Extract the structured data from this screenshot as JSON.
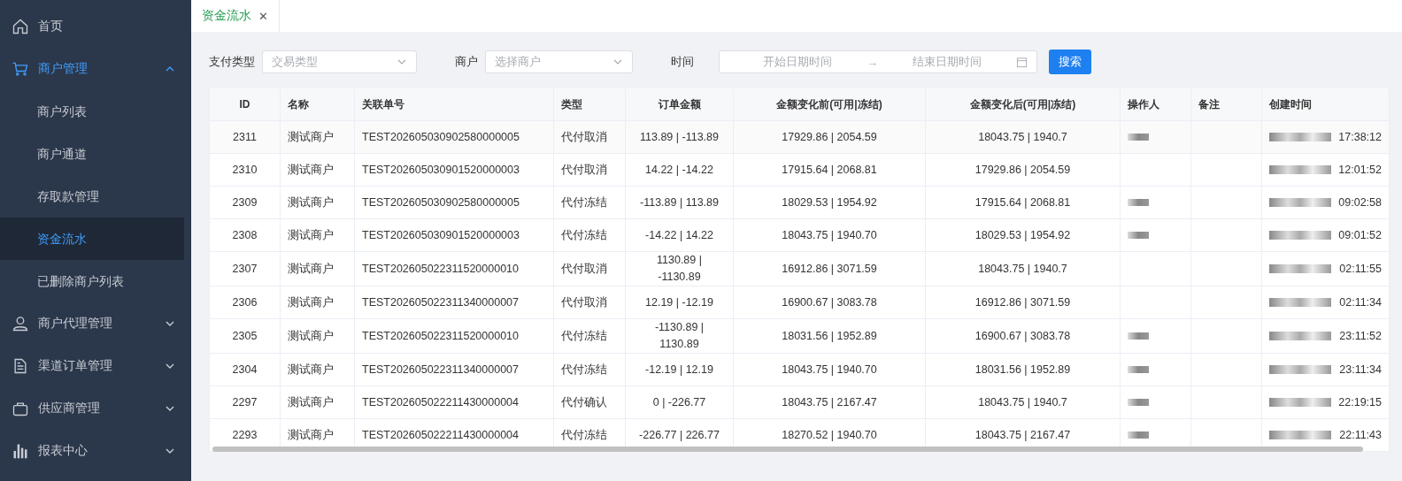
{
  "sidebar": {
    "items": [
      {
        "label": "首页",
        "expanded": false,
        "has_children": false
      },
      {
        "label": "商户管理",
        "expanded": true,
        "has_children": true,
        "children": [
          {
            "label": "商户列表",
            "selected": false
          },
          {
            "label": "商户通道",
            "selected": false
          },
          {
            "label": "存取款管理",
            "selected": false
          },
          {
            "label": "资金流水",
            "selected": true
          },
          {
            "label": "已删除商户列表",
            "selected": false
          }
        ]
      },
      {
        "label": "商户代理管理",
        "expanded": false,
        "has_children": true
      },
      {
        "label": "渠道订单管理",
        "expanded": false,
        "has_children": true
      },
      {
        "label": "供应商管理",
        "expanded": false,
        "has_children": true
      },
      {
        "label": "报表中心",
        "expanded": false,
        "has_children": true
      }
    ]
  },
  "tabs": [
    {
      "label": "资金流水",
      "selected": true,
      "close": "✕"
    }
  ],
  "filters": {
    "pay_type": {
      "label": "支付类型",
      "placeholder": "交易类型"
    },
    "merchant": {
      "label": "商户",
      "placeholder": "选择商户"
    },
    "time": {
      "label": "时间",
      "start_placeholder": "开始日期时间",
      "separator": "→",
      "end_placeholder": "结束日期时间"
    },
    "search_button": "搜索"
  },
  "table": {
    "columns": [
      "ID",
      "名称",
      "关联单号",
      "类型",
      "订单金额",
      "金额变化前(可用|冻结)",
      "金额变化后(可用|冻结)",
      "操作人",
      "备注",
      "创建时间"
    ],
    "rows": [
      {
        "id": "2311",
        "name": "测试商户",
        "ref": "TEST202605030902580000005",
        "type": "代付取消",
        "amount": "113.89 | -113.89",
        "before": "17929.86 | 2054.59",
        "after": "18043.75 | 1940.7",
        "operator_redacted": true,
        "time": "17:38:12"
      },
      {
        "id": "2310",
        "name": "测试商户",
        "ref": "TEST202605030901520000003",
        "type": "代付取消",
        "amount": "14.22 | -14.22",
        "before": "17915.64 | 2068.81",
        "after": "17929.86 | 2054.59",
        "operator_redacted": false,
        "time": "12:01:52"
      },
      {
        "id": "2309",
        "name": "测试商户",
        "ref": "TEST202605030902580000005",
        "type": "代付冻结",
        "amount": "-113.89 | 113.89",
        "before": "18029.53 | 1954.92",
        "after": "17915.64 | 2068.81",
        "operator_redacted": true,
        "time": "09:02:58"
      },
      {
        "id": "2308",
        "name": "测试商户",
        "ref": "TEST202605030901520000003",
        "type": "代付冻结",
        "amount": "-14.22 | 14.22",
        "before": "18043.75 | 1940.70",
        "after": "18029.53 | 1954.92",
        "operator_redacted": true,
        "time": "09:01:52"
      },
      {
        "id": "2307",
        "name": "测试商户",
        "ref": "TEST202605022311520000010",
        "type": "代付取消",
        "amount": "1130.89 | -1130.89",
        "before": "16912.86 | 3071.59",
        "after": "18043.75 | 1940.7",
        "operator_redacted": false,
        "time": "02:11:55"
      },
      {
        "id": "2306",
        "name": "测试商户",
        "ref": "TEST202605022311340000007",
        "type": "代付取消",
        "amount": "12.19 | -12.19",
        "before": "16900.67 | 3083.78",
        "after": "16912.86 | 3071.59",
        "operator_redacted": false,
        "time": "02:11:34"
      },
      {
        "id": "2305",
        "name": "测试商户",
        "ref": "TEST202605022311520000010",
        "type": "代付冻结",
        "amount": "-1130.89 | 1130.89",
        "before": "18031.56 | 1952.89",
        "after": "16900.67 | 3083.78",
        "operator_redacted": true,
        "time": "23:11:52"
      },
      {
        "id": "2304",
        "name": "测试商户",
        "ref": "TEST202605022311340000007",
        "type": "代付冻结",
        "amount": "-12.19 | 12.19",
        "before": "18043.75 | 1940.70",
        "after": "18031.56 | 1952.89",
        "operator_redacted": true,
        "time": "23:11:34"
      },
      {
        "id": "2297",
        "name": "测试商户",
        "ref": "TEST202605022211430000004",
        "type": "代付确认",
        "amount": "0 | -226.77",
        "before": "18043.75 | 2167.47",
        "after": "18043.75 | 1940.7",
        "operator_redacted": true,
        "time": "22:19:15"
      },
      {
        "id": "2293",
        "name": "测试商户",
        "ref": "TEST202605022211430000004",
        "type": "代付冻结",
        "amount": "-226.77 | 226.77",
        "before": "18270.52 | 1940.70",
        "after": "18043.75 | 2167.47",
        "operator_redacted": true,
        "time": "22:11:43"
      }
    ]
  }
}
